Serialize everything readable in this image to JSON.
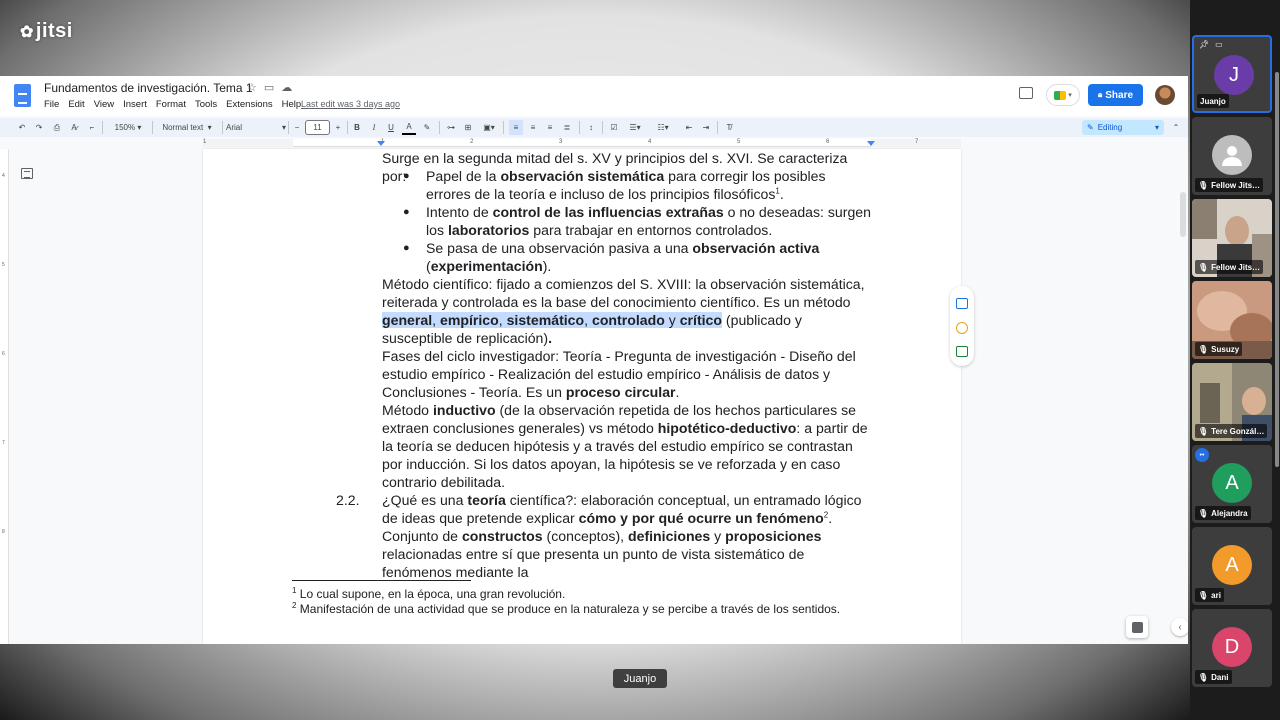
{
  "app": {
    "logo": "jitsi"
  },
  "docs": {
    "title": "Fundamentos de investigación. Tema 1",
    "menu": [
      "File",
      "Edit",
      "View",
      "Insert",
      "Format",
      "Tools",
      "Extensions",
      "Help"
    ],
    "last_edit": "Last edit was 3 days ago",
    "share_label": "Share",
    "toolbar": {
      "zoom": "150%",
      "style": "Normal text",
      "font": "Arial",
      "font_size": "11",
      "mode": "Editing"
    },
    "ruler_numbers": [
      "1",
      "1",
      "2",
      "3",
      "4",
      "5",
      "6",
      "7"
    ],
    "vruler_numbers": [
      "4",
      "5",
      "6",
      "7",
      "8"
    ],
    "body": {
      "intro": "Surge en la segunda mitad del s. XV y principios del s. XVI. Se caracteriza por:",
      "b1_pre": "Papel de la ",
      "b1_bold": "observación sistemática",
      "b1_post": " para corregir los posibles errores de la teoría e incluso de los principios filosóficos",
      "b1_sup": "1",
      "b1_end": ".",
      "b2_pre": "Intento de ",
      "b2_bold": "control de las influencias extrañas",
      "b2_mid": " o no deseadas: surgen los ",
      "b2_bold2": "laboratorios",
      "b2_post": " para trabajar en entornos controlados.",
      "b3_pre": "Se pasa de una observación pasiva a una ",
      "b3_bold": "observación activa",
      "b3_open": " (",
      "b3_bold2": "experimentación",
      "b3_close": ").",
      "metodo_pre": "Método científico: fijado a comienzos del S. XVIII: la observación sistemática, reiterada y controlada es la base del conocimiento científico. Es un método",
      "metodo_hl_1": "general",
      "metodo_hl_c1": ", ",
      "metodo_hl_2": "empírico",
      "metodo_hl_c2": ", ",
      "metodo_hl_3": "sistemático",
      "metodo_hl_c3": ", ",
      "metodo_hl_4": "controlado",
      "metodo_hl_y": " y ",
      "metodo_hl_5": "crítico",
      "metodo_post": " (publicado y susceptible de replicación)",
      "metodo_dot": ".",
      "fases_pre": "Fases del ciclo investigador: Teoría - Pregunta de investigación - Diseño del estudio empírico - Realización del estudio empírico - Análisis de datos y Conclusiones - Teoría. Es un ",
      "fases_bold": "proceso circular",
      "fases_end": ".",
      "ind_pre": "Método ",
      "ind_bold": "inductivo",
      "ind_mid": " (de la observación repetida de los hechos particulares se extraen conclusiones generales) vs método ",
      "ind_bold2": "hipotético-deductivo",
      "ind_post": ": a partir de la teoría se deducen hipótesis y a través del estudio empírico se contrastan por inducción. Si los datos apoyan, la hipótesis se ve reforzada y en caso contrario debilitada.",
      "sec_num": "2.2.",
      "sec_pre": "¿Qué es una ",
      "sec_bold": "teoría",
      "sec_mid": " científica?: elaboración conceptual, un entramado lógico de ideas que pretende explicar ",
      "sec_bold2": "cómo y por qué ocurre un fenómeno",
      "sec_sup": "2",
      "sec_mid2": ". Conjunto de ",
      "sec_bold3": "constructos",
      "sec_mid3": " (conceptos), ",
      "sec_bold4": "definiciones",
      "sec_mid4": " y ",
      "sec_bold5": "proposiciones",
      "sec_post": " relacionadas entre sí que presenta un punto de vista sistemático de fenómenos mediante la"
    },
    "footnotes": [
      {
        "num": "1",
        "text": " Lo cual supone, en la época, una gran revolución."
      },
      {
        "num": "2",
        "text": " Manifestación de una actividad que se produce en la naturaleza y se percibe a través de los sentidos."
      }
    ]
  },
  "speaker": "Juanjo",
  "participants": [
    {
      "name": "Juanjo",
      "initial": "J",
      "color": "#6a3ca8",
      "active": true
    },
    {
      "name": "Fellow Jits…",
      "initial": "",
      "color": "#bdbdbd"
    },
    {
      "name": "Fellow Jits…",
      "initial": "",
      "video": true
    },
    {
      "name": "Susuzy",
      "initial": "",
      "video": true
    },
    {
      "name": "Tere Gonzál…",
      "initial": "",
      "video": true
    },
    {
      "name": "Alejandra",
      "initial": "A",
      "color": "#1f9e5d"
    },
    {
      "name": "ari",
      "initial": "A",
      "color": "#f39b2a"
    },
    {
      "name": "Dani",
      "initial": "D",
      "color": "#d9456b"
    }
  ]
}
